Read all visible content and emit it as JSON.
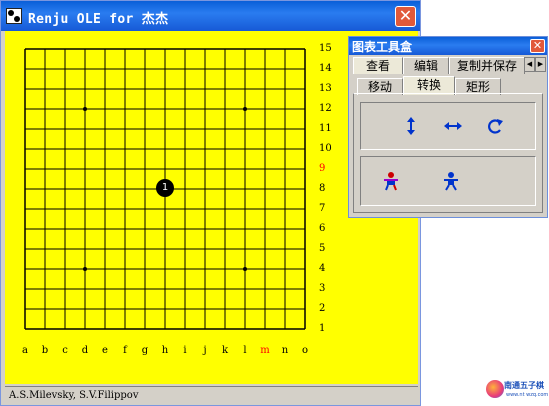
{
  "window": {
    "title": "Renju OLE for 杰杰",
    "close_symbol": "✕"
  },
  "board": {
    "row_labels": [
      "15",
      "14",
      "13",
      "12",
      "11",
      "10",
      "9",
      "8",
      "7",
      "6",
      "5",
      "4",
      "3",
      "2",
      "1"
    ],
    "column_labels": [
      "a",
      "b",
      "c",
      "d",
      "e",
      "f",
      "g",
      "h",
      "i",
      "j",
      "k",
      "l",
      "m",
      "n",
      "o"
    ],
    "highlighted_row": "9",
    "highlighted_column": "m",
    "background_color": "#ffff00",
    "highlight_color": "#ff0000",
    "stones": [
      {
        "move": "1",
        "color": "black",
        "column": "h",
        "row": "8"
      }
    ],
    "star_points": [
      [
        "d",
        "12"
      ],
      [
        "l",
        "12"
      ],
      [
        "d",
        "4"
      ],
      [
        "l",
        "4"
      ]
    ]
  },
  "status": {
    "text": "A.S.Milevsky, S.V.Filippov"
  },
  "toolbox": {
    "title": "图表工具盒",
    "close_symbol": "✕",
    "top_tabs": [
      "查看",
      "编辑",
      "复制并保存"
    ],
    "selected_top_tab": "查看",
    "scroll_left_symbol": "◀",
    "scroll_right_symbol": "▶",
    "sub_tabs": [
      "移动",
      "转换",
      "矩形"
    ],
    "selected_sub_tab": "转换",
    "tools": [
      {
        "name": "flip-vertical",
        "icon": "vertical-arrows-icon"
      },
      {
        "name": "flip-horizontal",
        "icon": "horizontal-arrows-icon"
      },
      {
        "name": "rotate",
        "icon": "rotate-icon"
      },
      {
        "name": "figure-1",
        "icon": "colored-figure-icon"
      },
      {
        "name": "figure-2",
        "icon": "blue-figure-icon"
      }
    ]
  },
  "watermark": {
    "text": "南通五子棋",
    "subtext": "www.nt wzq.com"
  }
}
